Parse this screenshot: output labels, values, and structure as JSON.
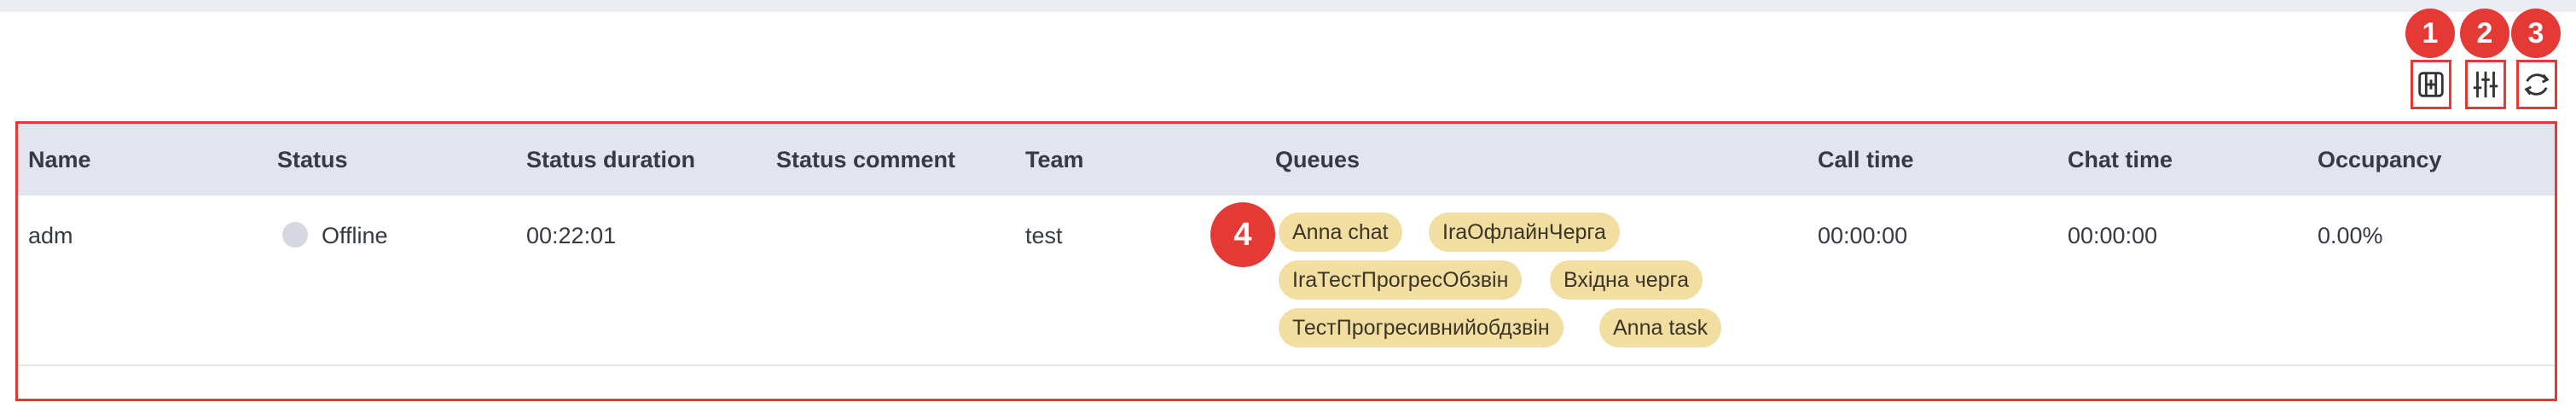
{
  "toolbar": {
    "icons": [
      "fit-columns-icon",
      "sliders-icon",
      "refresh-icon"
    ],
    "badges": [
      "1",
      "2",
      "3"
    ]
  },
  "region_badge": "4",
  "table": {
    "columns": [
      "Name",
      "Status",
      "Status duration",
      "Status comment",
      "Team",
      "Queues",
      "Call time",
      "Chat time",
      "Occupancy"
    ],
    "rows": [
      {
        "name": "adm",
        "status": "Offline",
        "status_duration": "00:22:01",
        "status_comment": "",
        "team": "test",
        "queues": [
          "Anna chat",
          "IraОфлайнЧерга",
          "IraТестПрогресОбзвін",
          "Вхідна черга",
          "ТестПрогресивнийобдзвін",
          "Anna task"
        ],
        "call_time": "00:00:00",
        "chat_time": "00:00:00",
        "occupancy": "0.00%"
      }
    ]
  },
  "colors": {
    "accent": "#e53935",
    "header_bg": "#e3e5ee",
    "chip_bg": "#f2dea0",
    "offline_dot": "#d5d8e1"
  }
}
